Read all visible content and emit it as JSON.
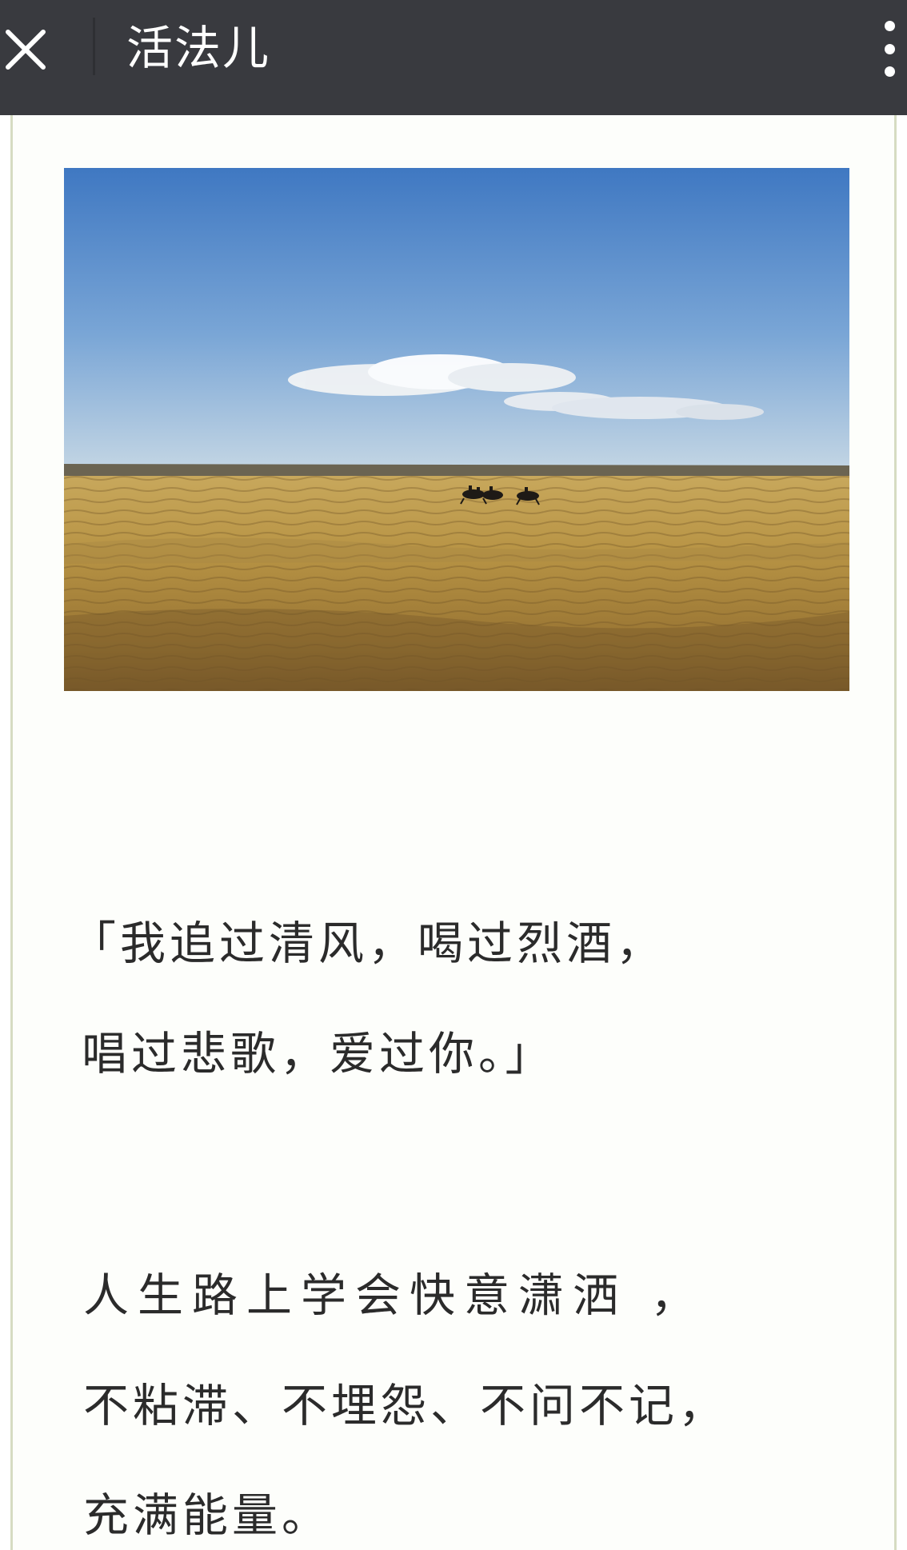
{
  "header": {
    "title": "活法儿",
    "close_icon": "close-icon",
    "more_icon": "more-vertical-icon",
    "background": "#393a3f"
  },
  "article": {
    "image": {
      "description_icon": "landscape-photo",
      "sky_color": "#4f86c6",
      "grass_color": "#b59447"
    },
    "quote_lines": [
      "「我追过清风，喝过烈酒，",
      "唱过悲歌，爱过你。」"
    ],
    "body_lines": [
      "人生路上学会快意潇洒 ，",
      "不粘滞、不埋怨、不问不记，",
      "充满能量。"
    ]
  }
}
